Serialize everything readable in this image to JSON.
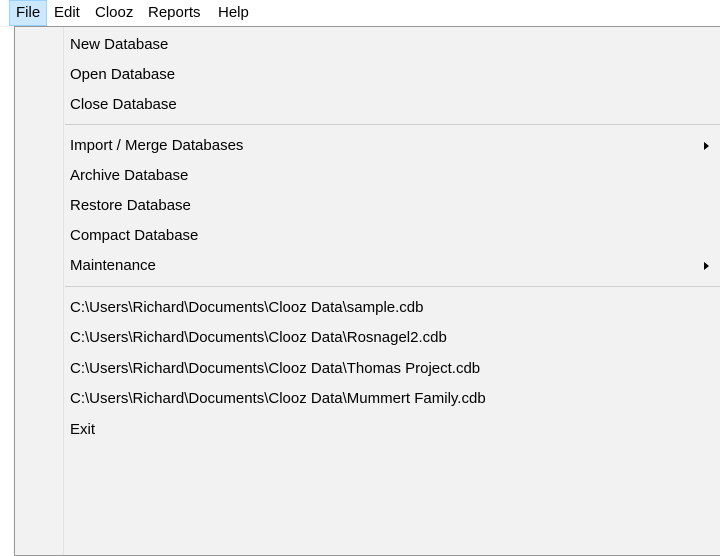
{
  "menubar": {
    "items": [
      {
        "label": "File"
      },
      {
        "label": "Edit"
      },
      {
        "label": "Clooz"
      },
      {
        "label": "Reports"
      },
      {
        "label": "Help"
      }
    ]
  },
  "file_menu": {
    "items": [
      {
        "label": "New Database"
      },
      {
        "label": "Open Database"
      },
      {
        "label": "Close Database"
      },
      {
        "label": "Import / Merge Databases",
        "submenu": true
      },
      {
        "label": "Archive Database"
      },
      {
        "label": "Restore Database"
      },
      {
        "label": "Compact Database"
      },
      {
        "label": "Maintenance",
        "submenu": true
      },
      {
        "label": "C:\\Users\\Richard\\Documents\\Clooz Data\\sample.cdb"
      },
      {
        "label": "C:\\Users\\Richard\\Documents\\Clooz Data\\Rosnagel2.cdb"
      },
      {
        "label": "C:\\Users\\Richard\\Documents\\Clooz Data\\Thomas Project.cdb"
      },
      {
        "label": "C:\\Users\\Richard\\Documents\\Clooz Data\\Mummert Family.cdb"
      },
      {
        "label": "Exit"
      }
    ]
  },
  "colors": {
    "menu_background": "#f2f2f2",
    "active_menubar_highlight": "#cce8ff",
    "active_menubar_border": "#99d1ff"
  }
}
